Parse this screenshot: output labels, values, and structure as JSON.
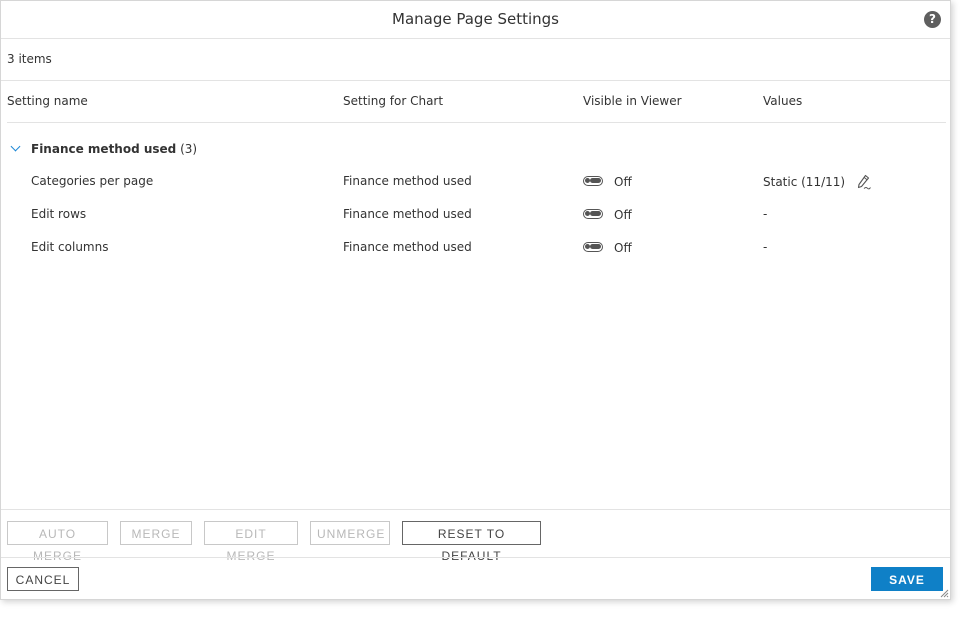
{
  "dialog": {
    "title": "Manage Page Settings",
    "help_icon": "?"
  },
  "list": {
    "count": "3 items"
  },
  "columns": {
    "setting_name": "Setting name",
    "setting_for_chart": "Setting for Chart",
    "visible_in_viewer": "Visible in Viewer",
    "values": "Values"
  },
  "group": {
    "label": "Finance method used",
    "count": "(3)",
    "expanded": true
  },
  "rows": [
    {
      "name": "Categories per page",
      "chart": "Finance method used",
      "visible": "Off",
      "value": "Static (11/11)",
      "editable": true
    },
    {
      "name": "Edit rows",
      "chart": "Finance method used",
      "visible": "Off",
      "value": "-",
      "editable": false
    },
    {
      "name": "Edit columns",
      "chart": "Finance method used",
      "visible": "Off",
      "value": "-",
      "editable": false
    }
  ],
  "toolbar": {
    "auto_merge": "AUTO MERGE",
    "merge": "MERGE",
    "edit_merge": "EDIT MERGE",
    "unmerge": "UNMERGE",
    "reset_to_default": "RESET TO DEFAULT"
  },
  "footer": {
    "cancel": "CANCEL",
    "save": "SAVE"
  },
  "icons": {
    "help": "help-icon",
    "expand": "chevron-down-icon",
    "edit": "edit-pencil-icon",
    "resize": "resize-grip-icon"
  },
  "colors": {
    "accent": "#0f80c7",
    "chevron": "#1e88d6",
    "disabled_text": "#b8b8b8"
  }
}
